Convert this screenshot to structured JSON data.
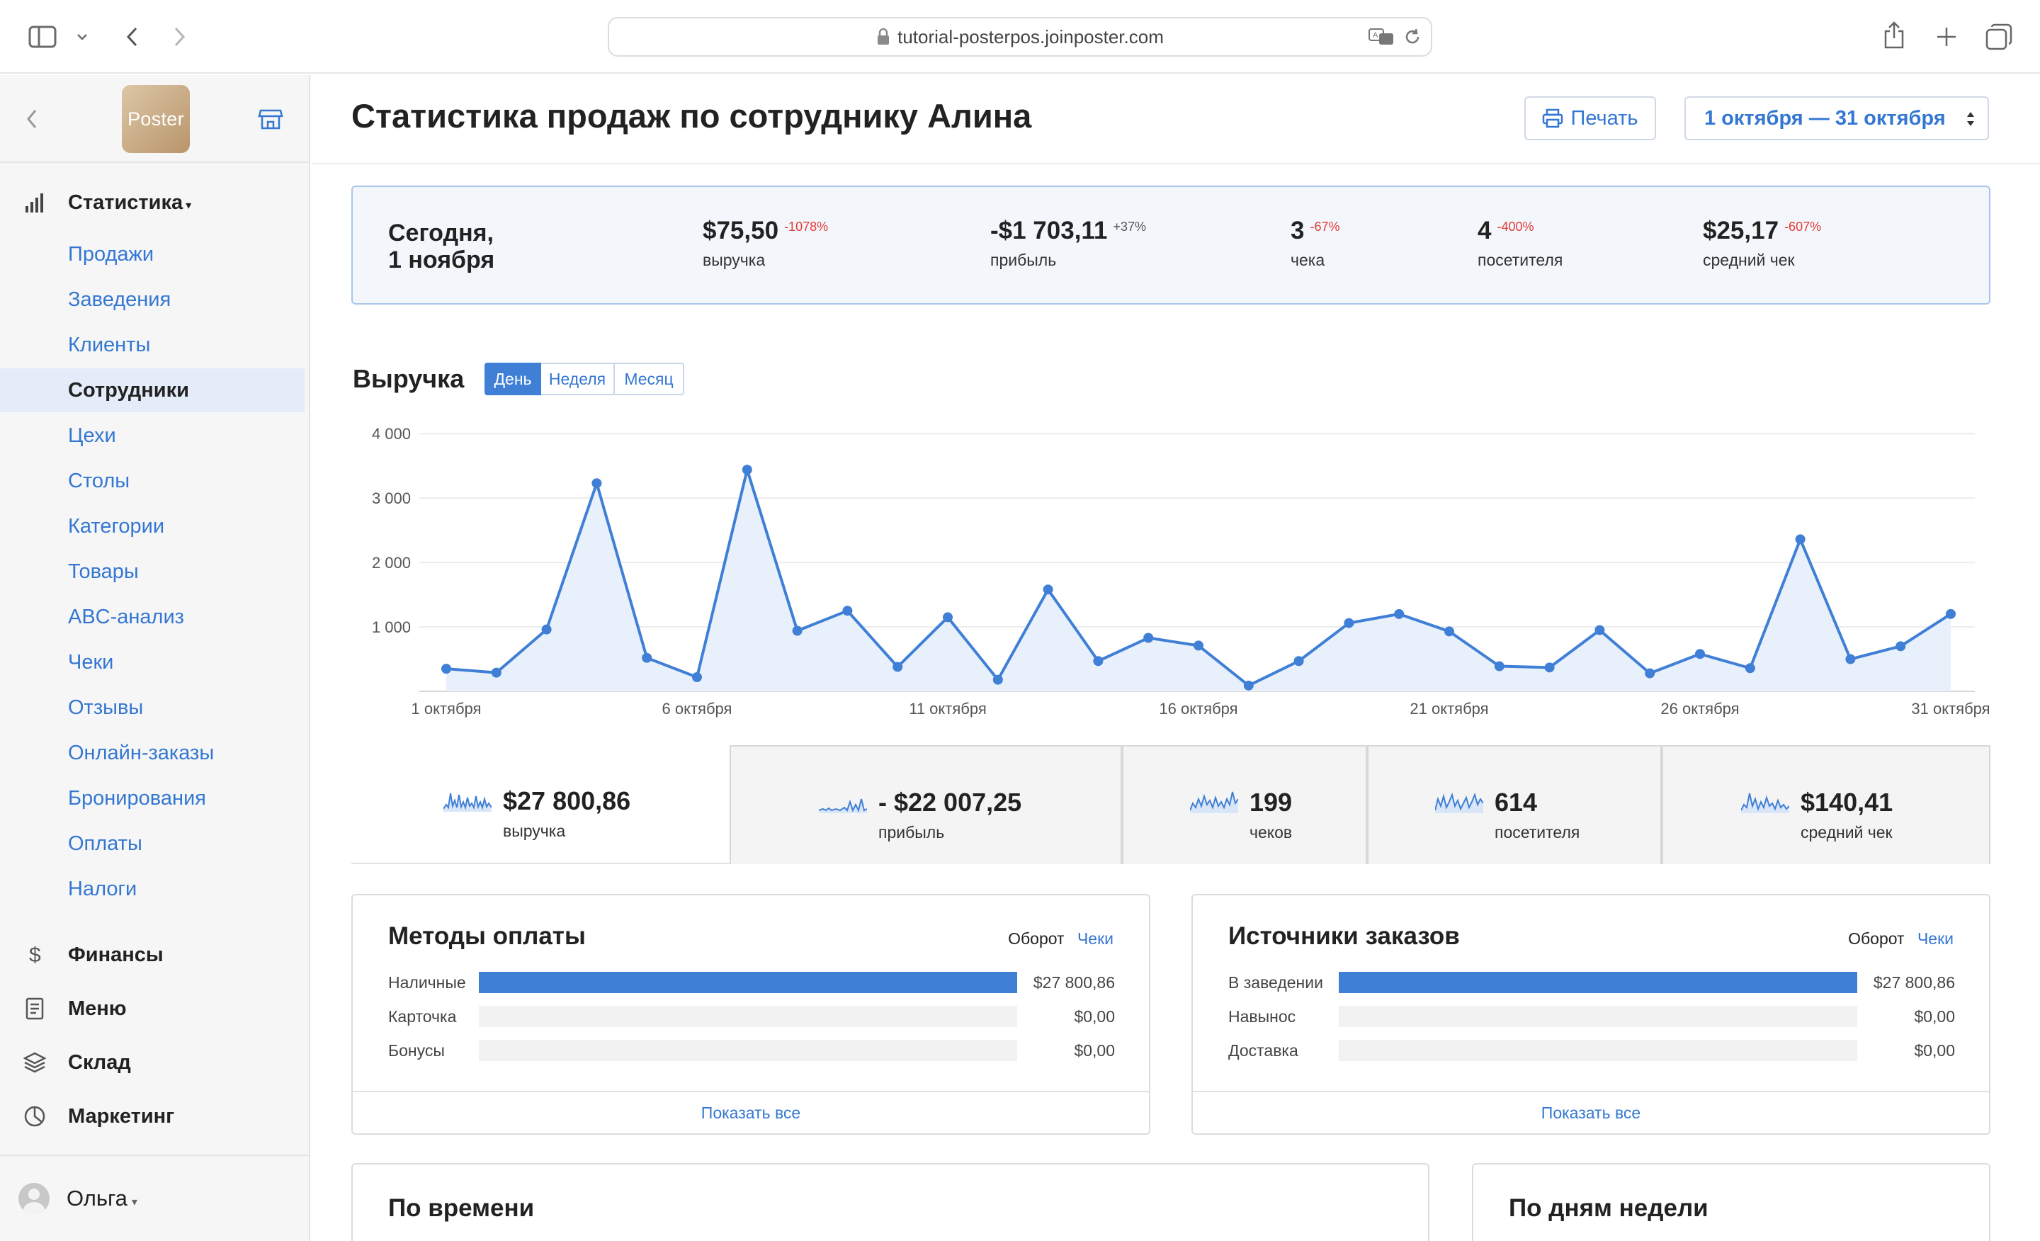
{
  "browser": {
    "url": "tutorial-posterpos.joinposter.com"
  },
  "sidebar": {
    "logo_text": "Poster",
    "statistics_label": "Статистика",
    "items": [
      {
        "label": "Продажи"
      },
      {
        "label": "Заведения"
      },
      {
        "label": "Клиенты"
      },
      {
        "label": "Сотрудники",
        "active": true
      },
      {
        "label": "Цехи"
      },
      {
        "label": "Столы"
      },
      {
        "label": "Категории"
      },
      {
        "label": "Товары"
      },
      {
        "label": "ABC-анализ"
      },
      {
        "label": "Чеки"
      },
      {
        "label": "Отзывы"
      },
      {
        "label": "Онлайн-заказы"
      },
      {
        "label": "Бронирования"
      },
      {
        "label": "Оплаты"
      },
      {
        "label": "Налоги"
      }
    ],
    "sections": [
      {
        "label": "Финансы",
        "icon": "dollar-icon"
      },
      {
        "label": "Меню",
        "icon": "document-icon"
      },
      {
        "label": "Склад",
        "icon": "layers-icon"
      },
      {
        "label": "Маркетинг",
        "icon": "pie-icon"
      }
    ],
    "user_name": "Ольга"
  },
  "header": {
    "title": "Статистика продаж по сотруднику Алина",
    "print_label": "Печать",
    "date_range": "1 октября — 31 октября"
  },
  "today": {
    "title_line1": "Сегодня,",
    "title_line2": "1 ноября",
    "kpis": [
      {
        "value": "$75,50",
        "delta": "-1078%",
        "label": "выручка"
      },
      {
        "value": "-$1 703,11",
        "delta": "+37%",
        "label": "прибыль"
      },
      {
        "value": "3",
        "delta": "-67%",
        "label": "чека"
      },
      {
        "value": "4",
        "delta": "-400%",
        "label": "посетителя"
      },
      {
        "value": "$25,17",
        "delta": "-607%",
        "label": "средний чек"
      }
    ]
  },
  "revenue": {
    "title": "Выручка",
    "tabs": [
      "День",
      "Неделя",
      "Месяц"
    ],
    "active_tab": 0
  },
  "chart_data": {
    "type": "area",
    "title": "Выручка",
    "categories": [
      "1 октября",
      "2 октября",
      "3 октября",
      "4 октября",
      "5 октября",
      "6 октября",
      "7 октября",
      "8 октября",
      "9 октября",
      "10 октября",
      "11 октября",
      "12 октября",
      "13 октября",
      "14 октября",
      "15 октября",
      "16 октября",
      "17 октября",
      "18 октября",
      "19 октября",
      "20 октября",
      "21 октября",
      "22 октября",
      "23 октября",
      "24 октября",
      "25 октября",
      "26 октября",
      "27 октября",
      "28 октября",
      "29 октября",
      "30 октября",
      "31 октября"
    ],
    "x_tick_labels": [
      "1 октября",
      "6 октября",
      "11 октября",
      "16 октября",
      "21 октября",
      "26 октября",
      "31 октября"
    ],
    "y_tick_labels": [
      "4 000",
      "3 000",
      "2 000",
      "1 000"
    ],
    "y_ticks": [
      4000,
      3000,
      2000,
      1000
    ],
    "values": [
      350,
      290,
      960,
      3230,
      520,
      220,
      3440,
      940,
      1250,
      380,
      1150,
      180,
      1580,
      470,
      830,
      710,
      90,
      470,
      1060,
      1200,
      930,
      390,
      370,
      950,
      280,
      580,
      360,
      2360,
      500,
      700,
      1200
    ],
    "ylim": [
      0,
      4200
    ],
    "grid": true,
    "color": "#3f7fd6",
    "fill": "#e8f0fb"
  },
  "summary": [
    {
      "value": "$27 800,86",
      "label": "выручка"
    },
    {
      "value": "- $22 007,25",
      "label": "прибыль"
    },
    {
      "value": "199",
      "label": "чеков"
    },
    {
      "value": "614",
      "label": "посетителя"
    },
    {
      "value": "$140,41",
      "label": "средний чек"
    }
  ],
  "payment_methods": {
    "title": "Методы оплаты",
    "tab_turnover": "Оборот",
    "tab_checks": "Чеки",
    "rows": [
      {
        "label": "Наличные",
        "value": "$27 800,86",
        "share": 1.0
      },
      {
        "label": "Карточка",
        "value": "$0,00",
        "share": 0
      },
      {
        "label": "Бонусы",
        "value": "$0,00",
        "share": 0
      }
    ],
    "show_all": "Показать все"
  },
  "order_sources": {
    "title": "Источники заказов",
    "tab_turnover": "Оборот",
    "tab_checks": "Чеки",
    "rows": [
      {
        "label": "В заведении",
        "value": "$27 800,86",
        "share": 1.0
      },
      {
        "label": "Навынос",
        "value": "$0,00",
        "share": 0
      },
      {
        "label": "Доставка",
        "value": "$0,00",
        "share": 0
      }
    ],
    "show_all": "Показать все"
  },
  "by_time": {
    "title": "По времени"
  },
  "by_weekday": {
    "title": "По дням недели"
  }
}
